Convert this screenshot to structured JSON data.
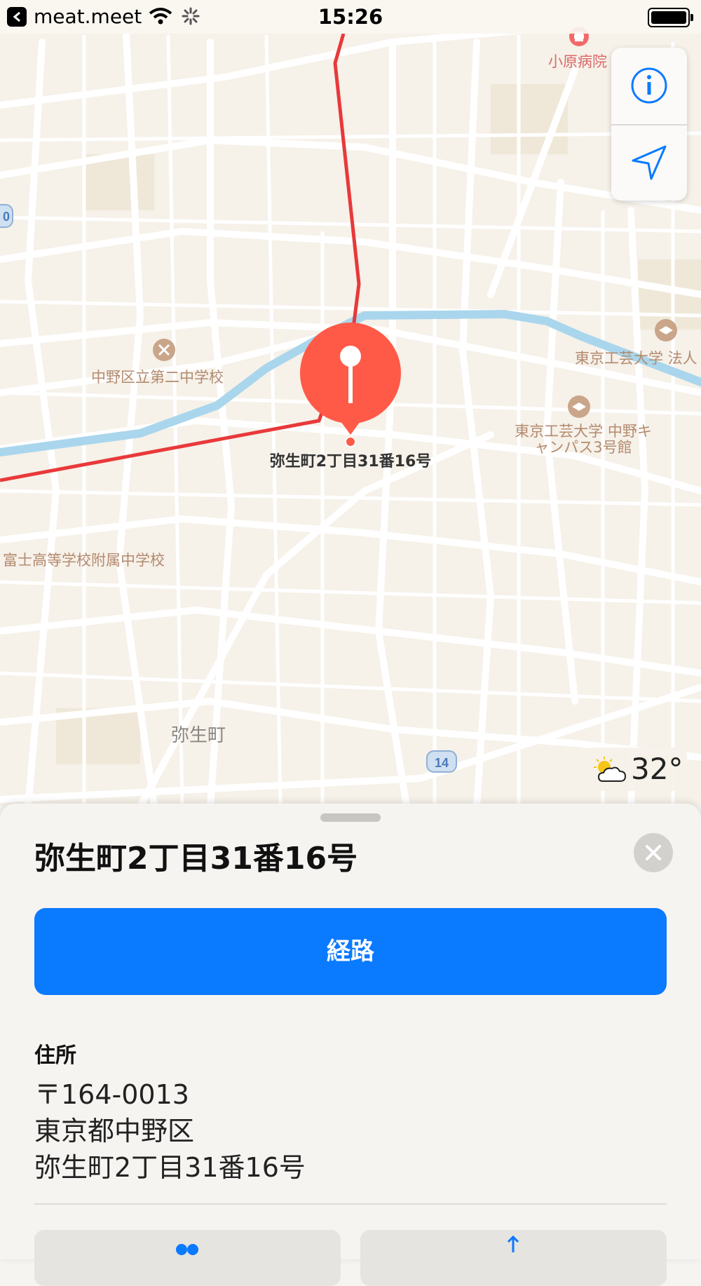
{
  "status_bar": {
    "back_app": "meat.meet",
    "time": "15:26"
  },
  "map": {
    "labels": {
      "hospital": "小原病院",
      "school1": "中野区立第二中学校",
      "university": "東京工芸大学 法人",
      "campus": "東京工芸大学 中野キャンパス3号館",
      "school2": "富士高等学校附属中学校",
      "district": "弥生町",
      "route_number": "14",
      "route_number_left": "0"
    },
    "pin_label": "弥生町2丁目31番16号",
    "weather": {
      "temperature": "32°",
      "icon": "partly-cloudy-icon"
    }
  },
  "sheet": {
    "title": "弥生町2丁目31番16号",
    "route_button": "経路",
    "address_heading": "住所",
    "address_lines": [
      "〒164-0013",
      "東京都中野区",
      "弥生町2丁目31番16号"
    ]
  },
  "colors": {
    "accent": "#0a7aff",
    "pin": "#ff5a47",
    "route_line": "#e8393b",
    "river": "#a9d6ec"
  }
}
